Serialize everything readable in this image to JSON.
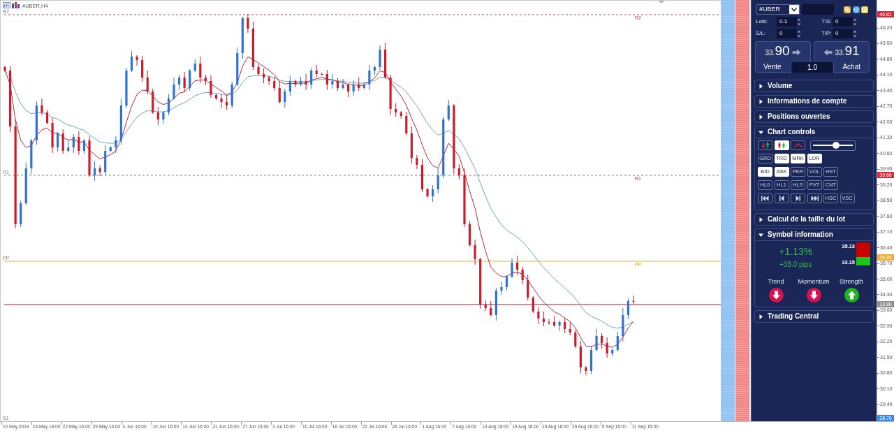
{
  "chart": {
    "title": "#UBER,H4",
    "levels": [
      {
        "kind": "r2",
        "left_label": "R2",
        "right_label": "R2",
        "price": "46.81"
      },
      {
        "kind": "r1",
        "left_label": "R1",
        "right_label": "R1",
        "price": "39.66"
      },
      {
        "kind": "pp",
        "left_label": "PP",
        "right_label": "PP",
        "price": "35.85"
      },
      {
        "kind": "last",
        "price": "33.80"
      },
      {
        "kind": "s1",
        "left_label": "S1",
        "price": "28.70"
      }
    ],
    "price_axis": [
      "46.20",
      "45.50",
      "44.80",
      "44.10",
      "43.40",
      "42.70",
      "42.00",
      "41.30",
      "40.60",
      "39.90",
      "39.20",
      "38.50",
      "37.80",
      "37.10",
      "36.40",
      "35.70",
      "35.00",
      "34.30",
      "33.60",
      "32.90",
      "32.20",
      "31.50",
      "30.80",
      "30.10",
      "29.40"
    ],
    "time_axis": [
      "10 May 2019",
      "16 May 16:00",
      "22 May 16:00",
      "29 May 16:00",
      "4 Jun 16:00",
      "10 Jun 16:00",
      "14 Jun 16:00",
      "21 Jun 16:00",
      "27 Jun 16:00",
      "3 Jul 16:00",
      "10 Jul 16:00",
      "16 Jul 16:00",
      "22 Jul 16:00",
      "26 Jul 16:00",
      "1 Aug 16:00",
      "7 Aug 16:00",
      "13 Aug 16:00",
      "19 Aug 16:00",
      "23 Aug 16:00",
      "29 Aug 16:00",
      "5 Sep 16:00",
      "11 Sep 16:00"
    ]
  },
  "panel": {
    "symbol": "#UBER",
    "order_fields": [
      {
        "label": "Lots:",
        "value": "0.1"
      },
      {
        "label": "T/S:",
        "value": "0"
      },
      {
        "label": "S/L:",
        "value": "0"
      },
      {
        "label": "T/P:",
        "value": "0"
      }
    ],
    "trade_buttons": [
      {
        "kind": "sell",
        "price_prefix": "33.",
        "price_pips": "90",
        "label": "Vente"
      },
      {
        "kind": "buy",
        "price_prefix": "33.",
        "price_pips": "91",
        "label": "Achat"
      }
    ],
    "volume": "1.0",
    "sections": [
      {
        "title": "Volume",
        "expanded": false
      },
      {
        "title": "Informations de compte",
        "expanded": false
      },
      {
        "title": "Positions ouvertes",
        "expanded": false
      },
      {
        "kind": "controls",
        "title": "Chart controls",
        "expanded": true,
        "icon_toggles": [
          {
            "kind": "arrows",
            "on": false
          },
          {
            "kind": "candles",
            "on": true
          },
          {
            "kind": "caret",
            "on": false
          }
        ],
        "slider": {
          "level": 0.6
        },
        "button_rows": [
          [
            {
              "label": "GRD",
              "on": false
            },
            {
              "label": "TRD",
              "on": true
            },
            {
              "label": "MRK",
              "on": true
            },
            {
              "label": "LDR",
              "on": true
            }
          ],
          [
            {
              "label": "BID",
              "on": true
            },
            {
              "label": "ASK",
              "on": true
            },
            {
              "label": "PER",
              "on": false
            },
            {
              "label": "VOL",
              "on": false
            },
            {
              "label": "HST",
              "on": false
            }
          ],
          [
            {
              "label": "HL0",
              "on": false
            },
            {
              "label": "HL1",
              "on": false
            },
            {
              "label": "HLS",
              "on": false
            },
            {
              "label": "PVT",
              "on": false
            },
            {
              "label": "CNT",
              "on": false
            }
          ],
          [
            {
              "kind": "first",
              "on": false
            },
            {
              "kind": "previous",
              "on": false
            },
            {
              "kind": "next",
              "on": false
            },
            {
              "kind": "last",
              "on": false
            },
            {
              "kind": "text",
              "label": "HSC",
              "on": false
            },
            {
              "kind": "text",
              "label": "VSC",
              "on": false
            }
          ]
        ]
      },
      {
        "title": "Calcul de la taille du lot",
        "expanded": false
      },
      {
        "kind": "symbol",
        "title": "Symbol information",
        "expanded": true,
        "change_percent": "+1.13%",
        "change_pips": "+38.0 pips",
        "high": "35.13",
        "low": "33.15",
        "indicators": [
          {
            "label": "Trend",
            "up": false
          },
          {
            "label": "Momentum",
            "up": false
          },
          {
            "label": "Strength",
            "up": true
          }
        ]
      },
      {
        "title": "Trading Central",
        "expanded": false
      }
    ]
  }
}
